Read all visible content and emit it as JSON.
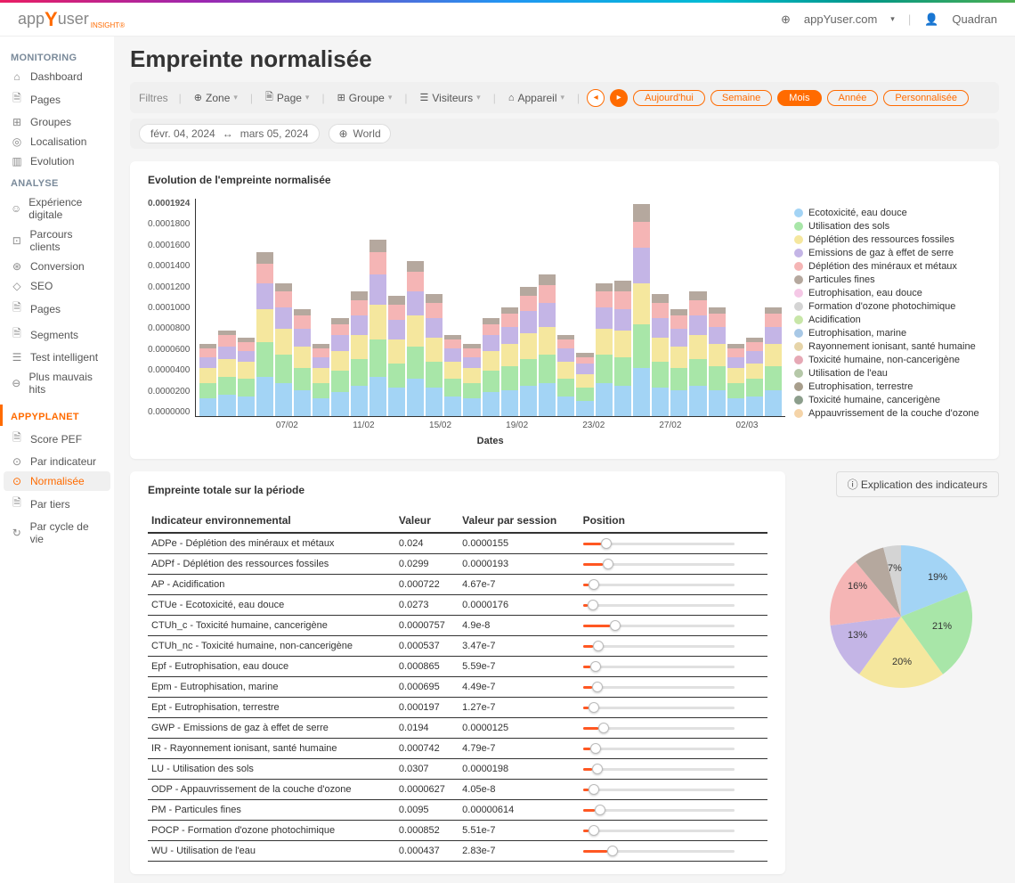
{
  "topbar": {
    "brand_app": "app",
    "brand_y": "Y",
    "brand_user": "user",
    "brand_sub": "INSIGHT®",
    "site": "appYuser.com",
    "username": "Quadran"
  },
  "sidebar": {
    "sections": [
      {
        "label": "MONITORING",
        "class": "",
        "items": [
          {
            "icon": "⌂",
            "label": "Dashboard"
          },
          {
            "icon": "🗎",
            "label": "Pages"
          },
          {
            "icon": "⊞",
            "label": "Groupes"
          },
          {
            "icon": "◎",
            "label": "Localisation"
          },
          {
            "icon": "▥",
            "label": "Evolution"
          }
        ]
      },
      {
        "label": "ANALYSE",
        "class": "",
        "items": [
          {
            "icon": "☺",
            "label": "Expérience digitale"
          },
          {
            "icon": "⊡",
            "label": "Parcours clients"
          },
          {
            "icon": "⊛",
            "label": "Conversion"
          },
          {
            "icon": "◇",
            "label": "SEO"
          },
          {
            "icon": "🗎",
            "label": "Pages"
          },
          {
            "icon": "🗎",
            "label": "Segments"
          },
          {
            "icon": "☰",
            "label": "Test intelligent"
          },
          {
            "icon": "⊖",
            "label": "Plus mauvais hits"
          }
        ]
      },
      {
        "label": "APPYPLANET",
        "class": "orange",
        "items": [
          {
            "icon": "🗎",
            "label": "Score PEF"
          },
          {
            "icon": "⊙",
            "label": "Par indicateur"
          },
          {
            "icon": "⊙",
            "label": "Normalisée",
            "active": true
          },
          {
            "icon": "🗎",
            "label": "Par tiers"
          },
          {
            "icon": "↻",
            "label": "Par cycle de vie"
          }
        ]
      }
    ]
  },
  "page": {
    "title": "Empreinte normalisée"
  },
  "filters": {
    "label": "Filtres",
    "zone": "Zone",
    "page": "Page",
    "groupe": "Groupe",
    "visiteurs": "Visiteurs",
    "appareil": "Appareil",
    "periods": [
      "Aujourd'hui",
      "Semaine",
      "Mois",
      "Année",
      "Personnalisée"
    ],
    "active_period": "Mois"
  },
  "subbar": {
    "date_from": "févr. 04, 2024",
    "date_to": "mars 05, 2024",
    "region": "World"
  },
  "chart_data": {
    "type": "bar",
    "title": "Evolution de l'empreinte normalisée",
    "xlabel": "Dates",
    "ylabel": "",
    "ylim": [
      0,
      0.0001924
    ],
    "y_ticks": [
      "0.0001924",
      "0.0001800",
      "0.0001600",
      "0.0001400",
      "0.0001200",
      "0.0001000",
      "0.0000800",
      "0.0000600",
      "0.0000400",
      "0.0000200",
      "0.0000000"
    ],
    "x_ticks": [
      "07/02",
      "11/02",
      "15/02",
      "19/02",
      "23/02",
      "27/02",
      "02/03"
    ],
    "categories": [
      "04/02",
      "05/02",
      "06/02",
      "07/02",
      "08/02",
      "09/02",
      "10/02",
      "11/02",
      "12/02",
      "13/02",
      "14/02",
      "15/02",
      "16/02",
      "17/02",
      "18/02",
      "19/02",
      "20/02",
      "21/02",
      "22/02",
      "23/02",
      "24/02",
      "25/02",
      "26/02",
      "27/02",
      "28/02",
      "29/02",
      "01/03",
      "02/03",
      "03/03",
      "04/03",
      "05/03"
    ],
    "legend": [
      {
        "name": "Ecotoxicité, eau douce",
        "color": "#a3d4f5"
      },
      {
        "name": "Utilisation des sols",
        "color": "#a8e6a8"
      },
      {
        "name": "Déplétion des ressources fossiles",
        "color": "#f5e79e"
      },
      {
        "name": "Emissions de gaz à effet de serre",
        "color": "#c4b5e6"
      },
      {
        "name": "Déplétion des minéraux et métaux",
        "color": "#f5b5b5"
      },
      {
        "name": "Particules fines",
        "color": "#b5a89e"
      },
      {
        "name": "Eutrophisation, eau douce",
        "color": "#f5c8e6"
      },
      {
        "name": "Formation d'ozone photochimique",
        "color": "#d4d4d4"
      },
      {
        "name": "Acidification",
        "color": "#c8e6a8"
      },
      {
        "name": "Eutrophisation, marine",
        "color": "#a8c8e6"
      },
      {
        "name": "Rayonnement ionisant, santé humaine",
        "color": "#e6d4a8"
      },
      {
        "name": "Toxicité humaine, non-cancerigène",
        "color": "#e6a8b5"
      },
      {
        "name": "Utilisation de l'eau",
        "color": "#b5c8a8"
      },
      {
        "name": "Eutrophisation, terrestre",
        "color": "#a89e8c"
      },
      {
        "name": "Toxicité humaine, cancerigène",
        "color": "#8c9e8c"
      },
      {
        "name": "Appauvrissement de la couche d'ozone",
        "color": "#f5d4a8"
      }
    ],
    "series_colors": [
      "#a3d4f5",
      "#a8e6a8",
      "#f5e79e",
      "#c4b5e6",
      "#f5b5b5",
      "#b5a89e"
    ],
    "stacked_values_pct": [
      [
        8,
        7,
        7,
        5,
        4,
        2
      ],
      [
        10,
        8,
        8,
        6,
        5,
        2
      ],
      [
        9,
        8,
        8,
        5,
        4,
        2
      ],
      [
        18,
        16,
        15,
        12,
        9,
        5
      ],
      [
        15,
        13,
        12,
        10,
        7,
        4
      ],
      [
        12,
        10,
        10,
        8,
        6,
        3
      ],
      [
        8,
        7,
        7,
        5,
        4,
        2
      ],
      [
        11,
        10,
        9,
        7,
        5,
        3
      ],
      [
        14,
        12,
        11,
        9,
        7,
        4
      ],
      [
        18,
        17,
        16,
        14,
        10,
        6
      ],
      [
        13,
        11,
        11,
        9,
        7,
        4
      ],
      [
        17,
        15,
        14,
        11,
        9,
        5
      ],
      [
        13,
        12,
        11,
        9,
        7,
        4
      ],
      [
        9,
        8,
        8,
        6,
        4,
        2
      ],
      [
        8,
        7,
        7,
        5,
        4,
        2
      ],
      [
        11,
        10,
        9,
        7,
        5,
        3
      ],
      [
        12,
        11,
        10,
        8,
        6,
        3
      ],
      [
        14,
        12,
        12,
        10,
        7,
        4
      ],
      [
        15,
        13,
        13,
        11,
        8,
        5
      ],
      [
        9,
        8,
        8,
        6,
        4,
        2
      ],
      [
        7,
        6,
        6,
        5,
        3,
        2
      ],
      [
        15,
        13,
        12,
        10,
        7,
        4
      ],
      [
        14,
        13,
        12,
        10,
        8,
        5
      ],
      [
        22,
        20,
        19,
        16,
        12,
        8
      ],
      [
        13,
        12,
        11,
        9,
        7,
        4
      ],
      [
        12,
        10,
        10,
        8,
        6,
        3
      ],
      [
        14,
        12,
        11,
        9,
        7,
        4
      ],
      [
        12,
        11,
        10,
        8,
        6,
        3
      ],
      [
        8,
        7,
        7,
        5,
        4,
        2
      ],
      [
        9,
        8,
        7,
        6,
        4,
        2
      ],
      [
        12,
        11,
        10,
        8,
        6,
        3
      ]
    ]
  },
  "table": {
    "title": "Empreinte totale sur la période",
    "indicators_btn": "Explication des indicateurs",
    "headers": [
      "Indicateur environnemental",
      "Valeur",
      "Valeur par session",
      "Position"
    ],
    "rows": [
      {
        "name": "ADPe - Déplétion des minéraux et métaux",
        "val": "0.024",
        "vps": "0.0000155",
        "pos": 12
      },
      {
        "name": "ADPf - Déplétion des ressources fossiles",
        "val": "0.0299",
        "vps": "0.0000193",
        "pos": 13
      },
      {
        "name": "AP - Acidification",
        "val": "0.000722",
        "vps": "4.67e-7",
        "pos": 4
      },
      {
        "name": "CTUe - Ecotoxicité, eau douce",
        "val": "0.0273",
        "vps": "0.0000176",
        "pos": 3
      },
      {
        "name": "CTUh_c - Toxicité humaine, cancerigène",
        "val": "0.0000757",
        "vps": "4.9e-8",
        "pos": 18
      },
      {
        "name": "CTUh_nc - Toxicité humaine, non-cancerigène",
        "val": "0.000537",
        "vps": "3.47e-7",
        "pos": 7
      },
      {
        "name": "Epf - Eutrophisation, eau douce",
        "val": "0.000865",
        "vps": "5.59e-7",
        "pos": 5
      },
      {
        "name": "Epm - Eutrophisation, marine",
        "val": "0.000695",
        "vps": "4.49e-7",
        "pos": 6
      },
      {
        "name": "Ept - Eutrophisation, terrestre",
        "val": "0.000197",
        "vps": "1.27e-7",
        "pos": 4
      },
      {
        "name": "GWP - Emissions de gaz à effet de serre",
        "val": "0.0194",
        "vps": "0.0000125",
        "pos": 10
      },
      {
        "name": "IR - Rayonnement ionisant, santé humaine",
        "val": "0.000742",
        "vps": "4.79e-7",
        "pos": 5
      },
      {
        "name": "LU - Utilisation des sols",
        "val": "0.0307",
        "vps": "0.0000198",
        "pos": 6
      },
      {
        "name": "ODP - Appauvrissement de la couche d'ozone",
        "val": "0.0000627",
        "vps": "4.05e-8",
        "pos": 4
      },
      {
        "name": "PM - Particules fines",
        "val": "0.0095",
        "vps": "0.00000614",
        "pos": 8
      },
      {
        "name": "POCP - Formation d'ozone photochimique",
        "val": "0.000852",
        "vps": "5.51e-7",
        "pos": 4
      },
      {
        "name": "WU - Utilisation de l'eau",
        "val": "0.000437",
        "vps": "2.83e-7",
        "pos": 16
      }
    ]
  },
  "pie": {
    "slices": [
      {
        "pct": 19,
        "color": "#a3d4f5"
      },
      {
        "pct": 21,
        "color": "#a8e6a8"
      },
      {
        "pct": 20,
        "color": "#f5e79e"
      },
      {
        "pct": 13,
        "color": "#c4b5e6"
      },
      {
        "pct": 16,
        "color": "#f5b5b5"
      },
      {
        "pct": 7,
        "color": "#b5a89e"
      },
      {
        "pct": 4,
        "color": "#d4d4d4"
      }
    ],
    "labels": [
      "19%",
      "21%",
      "20%",
      "13%",
      "16%",
      "7%"
    ]
  }
}
